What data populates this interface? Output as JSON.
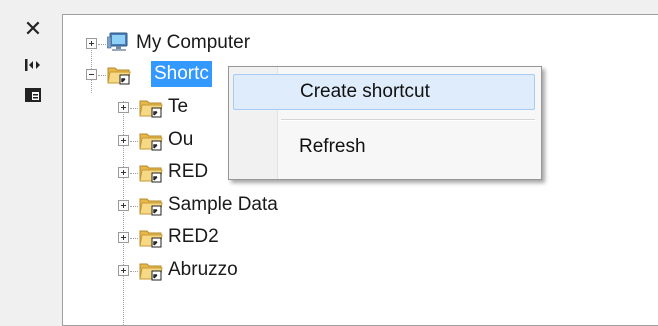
{
  "toolstrip": {
    "close_icon": "close-icon",
    "autohide_icon": "autohide-icon",
    "properties_icon": "properties-icon"
  },
  "tree": {
    "root": {
      "label": "My Computer",
      "icon": "computer-icon"
    },
    "shortcuts": {
      "label": "Shortc",
      "icon": "shortcut-folder-icon",
      "selected": true
    },
    "children": [
      {
        "label": "Te",
        "icon": "shortcut-folder-icon"
      },
      {
        "label": "Ou",
        "icon": "shortcut-folder-icon"
      },
      {
        "label": "RED",
        "icon": "shortcut-folder-icon"
      },
      {
        "label": "Sample Data",
        "icon": "shortcut-folder-icon"
      },
      {
        "label": "RED2",
        "icon": "shortcut-folder-icon"
      },
      {
        "label": "Abruzzo",
        "icon": "shortcut-folder-icon"
      }
    ]
  },
  "context_menu": {
    "items": [
      {
        "label": "Create shortcut",
        "hover": true
      },
      {
        "label": "Refresh",
        "hover": false
      }
    ]
  },
  "colors": {
    "selection": "#3399ff",
    "menu_hover": "#dfecfb",
    "folder": "#f4c95d"
  }
}
